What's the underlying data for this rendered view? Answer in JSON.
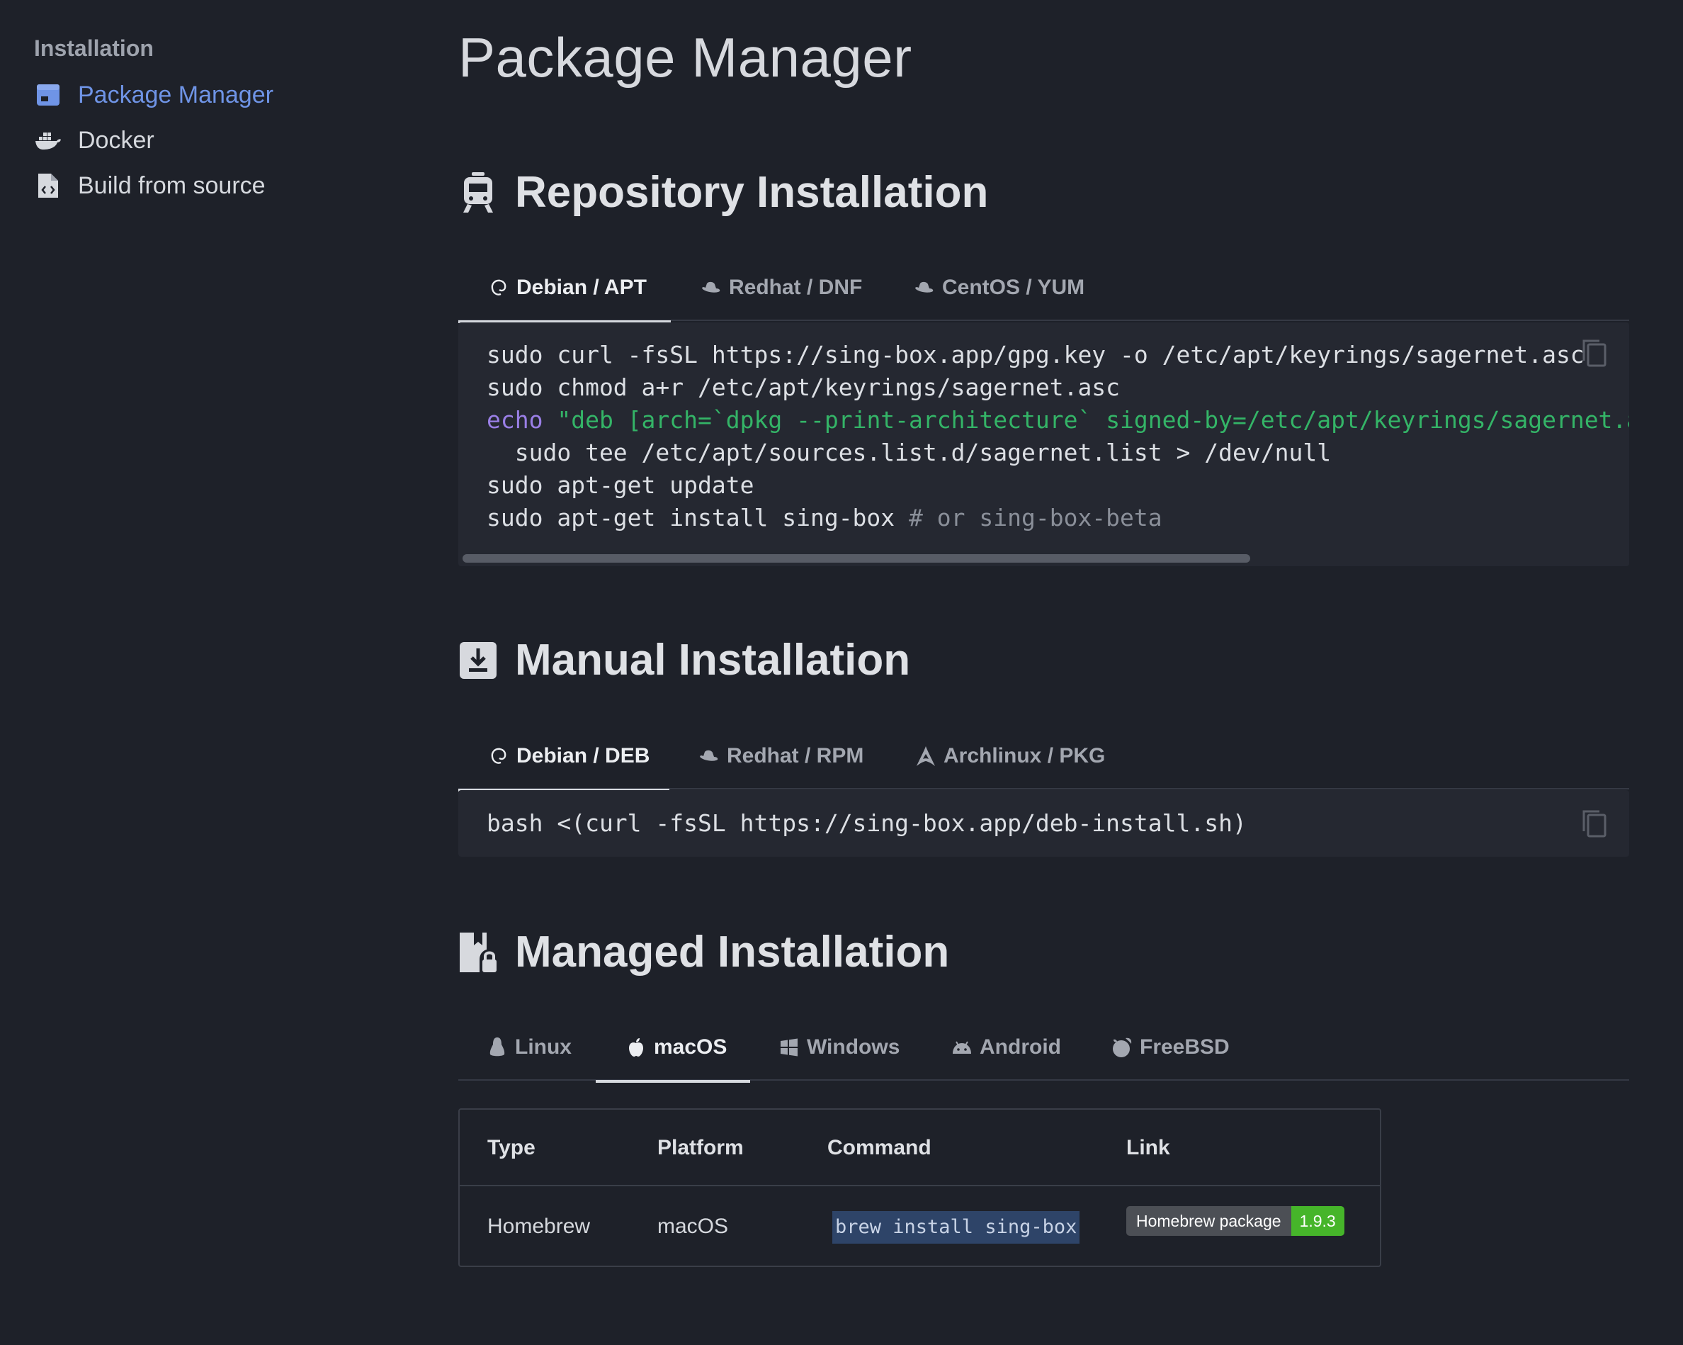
{
  "sidebar": {
    "title": "Installation",
    "items": [
      {
        "label": "Package Manager",
        "icon": "package-icon",
        "active": true
      },
      {
        "label": "Docker",
        "icon": "docker-icon",
        "active": false
      },
      {
        "label": "Build from source",
        "icon": "file-code-icon",
        "active": false
      }
    ]
  },
  "page": {
    "title": "Package Manager"
  },
  "repository": {
    "heading": "Repository Installation",
    "icon": "train-icon",
    "tabs": [
      {
        "label": "Debian / APT",
        "icon": "debian-icon",
        "active": true
      },
      {
        "label": "Redhat / DNF",
        "icon": "redhat-icon",
        "active": false
      },
      {
        "label": "CentOS / YUM",
        "icon": "redhat-icon",
        "active": false
      }
    ],
    "code": {
      "line1": "sudo curl -fsSL https://sing-box.app/gpg.key -o /etc/apt/keyrings/sagernet.asc",
      "line2": "sudo chmod a+r /etc/apt/keyrings/sagernet.asc",
      "line3_kw": "echo",
      "line3_str": " \"deb [arch=`dpkg --print-architecture` signed-by=/etc/apt/keyrings/sagernet.asc] https://deb.sagernet.org/ * *\" | \\",
      "line4": "  sudo tee /etc/apt/sources.list.d/sagernet.list > /dev/null",
      "line5": "sudo apt-get update",
      "line6_cmd": "sudo apt-get install sing-box ",
      "line6_comment": "# or sing-box-beta"
    }
  },
  "manual": {
    "heading": "Manual Installation",
    "icon": "download-icon",
    "tabs": [
      {
        "label": "Debian / DEB",
        "icon": "debian-icon",
        "active": true
      },
      {
        "label": "Redhat / RPM",
        "icon": "redhat-icon",
        "active": false
      },
      {
        "label": "Archlinux / PKG",
        "icon": "arch-icon",
        "active": false
      }
    ],
    "code": {
      "line1": "bash <(curl -fsSL https://sing-box.app/deb-install.sh)"
    }
  },
  "managed": {
    "heading": "Managed Installation",
    "icon": "package-lock-icon",
    "tabs": [
      {
        "label": "Linux",
        "icon": "linux-icon",
        "active": false
      },
      {
        "label": "macOS",
        "icon": "apple-icon",
        "active": true
      },
      {
        "label": "Windows",
        "icon": "windows-icon",
        "active": false
      },
      {
        "label": "Android",
        "icon": "android-icon",
        "active": false
      },
      {
        "label": "FreeBSD",
        "icon": "freebsd-icon",
        "active": false
      }
    ],
    "table": {
      "headers": [
        "Type",
        "Platform",
        "Command",
        "Link"
      ],
      "rows": [
        {
          "type": "Homebrew",
          "platform": "macOS",
          "command": "brew install sing-box",
          "badge_label": "Homebrew package",
          "badge_value": "1.9.3"
        }
      ]
    }
  },
  "colors": {
    "background": "#1e2129",
    "accent": "#6f94e6",
    "keyword": "#9a7fe6",
    "string": "#34b467",
    "badge_green": "#46b52a"
  }
}
